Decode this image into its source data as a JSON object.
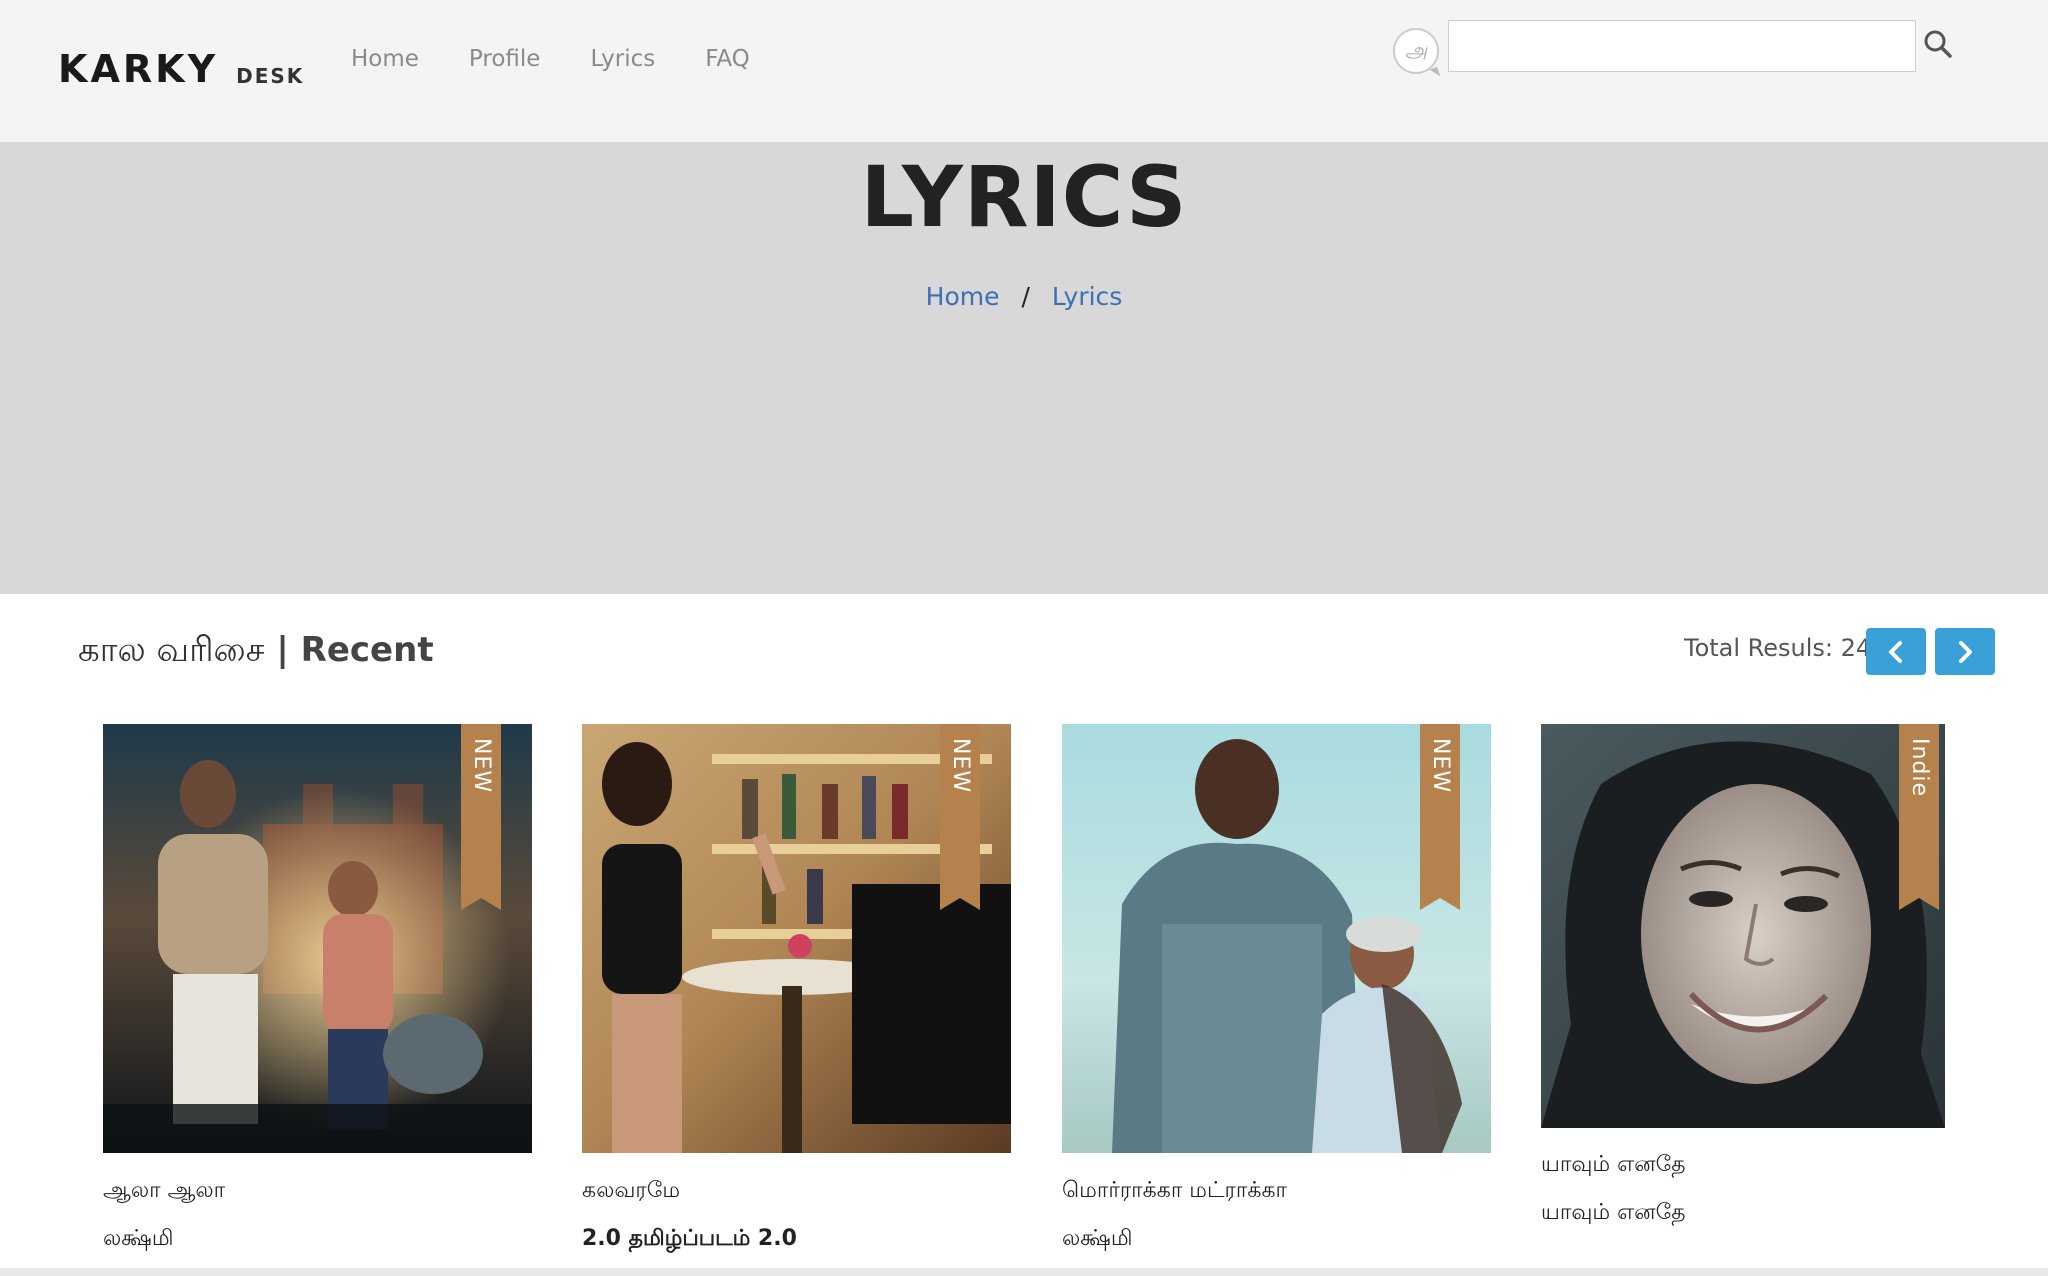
{
  "header": {
    "logo_main": "KARKY",
    "logo_sub": "DESK",
    "nav": [
      "Home",
      "Profile",
      "Lyrics",
      "FAQ"
    ],
    "tamil_toggle": "அ",
    "search_placeholder": ""
  },
  "hero": {
    "title": "LYRICS",
    "breadcrumb": [
      "Home",
      "Lyrics"
    ],
    "separator": "/"
  },
  "section": {
    "title_tamil": "கால வரிசை",
    "title_sep": " | ",
    "title_en": "Recent",
    "total": "Total Resuls: 24"
  },
  "cards": [
    {
      "ribbon": "NEW",
      "title": "ஆலா ஆலா",
      "subtitle": "லக்ஷ்மி"
    },
    {
      "ribbon": "NEW",
      "title": "கலவரமே",
      "subtitle": "2.0 தமிழ்ப்படம் 2.0"
    },
    {
      "ribbon": "NEW",
      "title": "மொர்ராக்கா மட்ராக்கா",
      "subtitle": "லக்ஷ்மி"
    },
    {
      "ribbon": "Indie",
      "title": "யாவும் எனதே",
      "subtitle": "யாவும் எனதே"
    }
  ],
  "colors": {
    "header_bg": "#f4f4f4",
    "hero_bg": "#d8d8d8",
    "link": "#3b6fb6",
    "pager": "#3aa0d8",
    "ribbon": "#b5824e"
  }
}
